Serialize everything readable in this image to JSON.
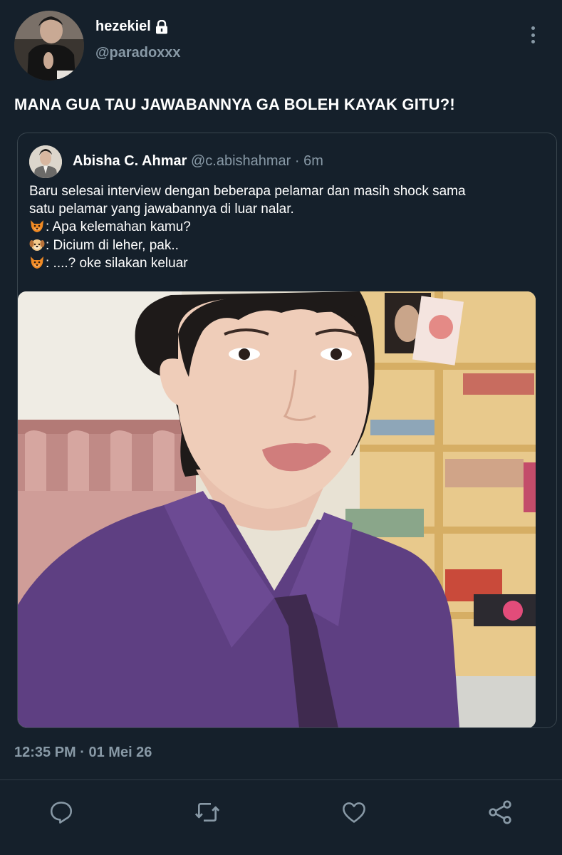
{
  "tweet": {
    "author": {
      "display_name": "hezekiel",
      "handle": "@paradoxxx",
      "protected_icon": "lock-icon"
    },
    "text": "MANA GUA TAU JAWABANNYA GA BOLEH KAYAK GITU?!",
    "timestamp": "12:35 PM · 01 Mei 26"
  },
  "quoted_tweet": {
    "author": {
      "display_name": "Abisha C. Ahmar",
      "handle": "@c.abishahmar",
      "separator": "·",
      "time": "6m"
    },
    "lines": [
      {
        "emoji": "",
        "text": "Baru selesai interview dengan beberapa pelamar dan masih shock sama"
      },
      {
        "emoji": "",
        "text": "satu pelamar yang jawabannya di luar nalar."
      },
      {
        "emoji": "fox-emoji",
        "text": ": Apa kelemahan kamu?"
      },
      {
        "emoji": "dog-emoji",
        "text": ": Dicium di leher, pak.."
      },
      {
        "emoji": "fox-emoji",
        "text": ": ....? oke silakan keluar"
      }
    ],
    "media": "photo"
  },
  "actions": {
    "reply_icon": "reply-icon",
    "retweet_icon": "retweet-icon",
    "like_icon": "heart-icon",
    "share_icon": "share-icon"
  },
  "colors": {
    "background": "#15202b",
    "secondary_text": "#8899a6",
    "border": "#38444d"
  }
}
